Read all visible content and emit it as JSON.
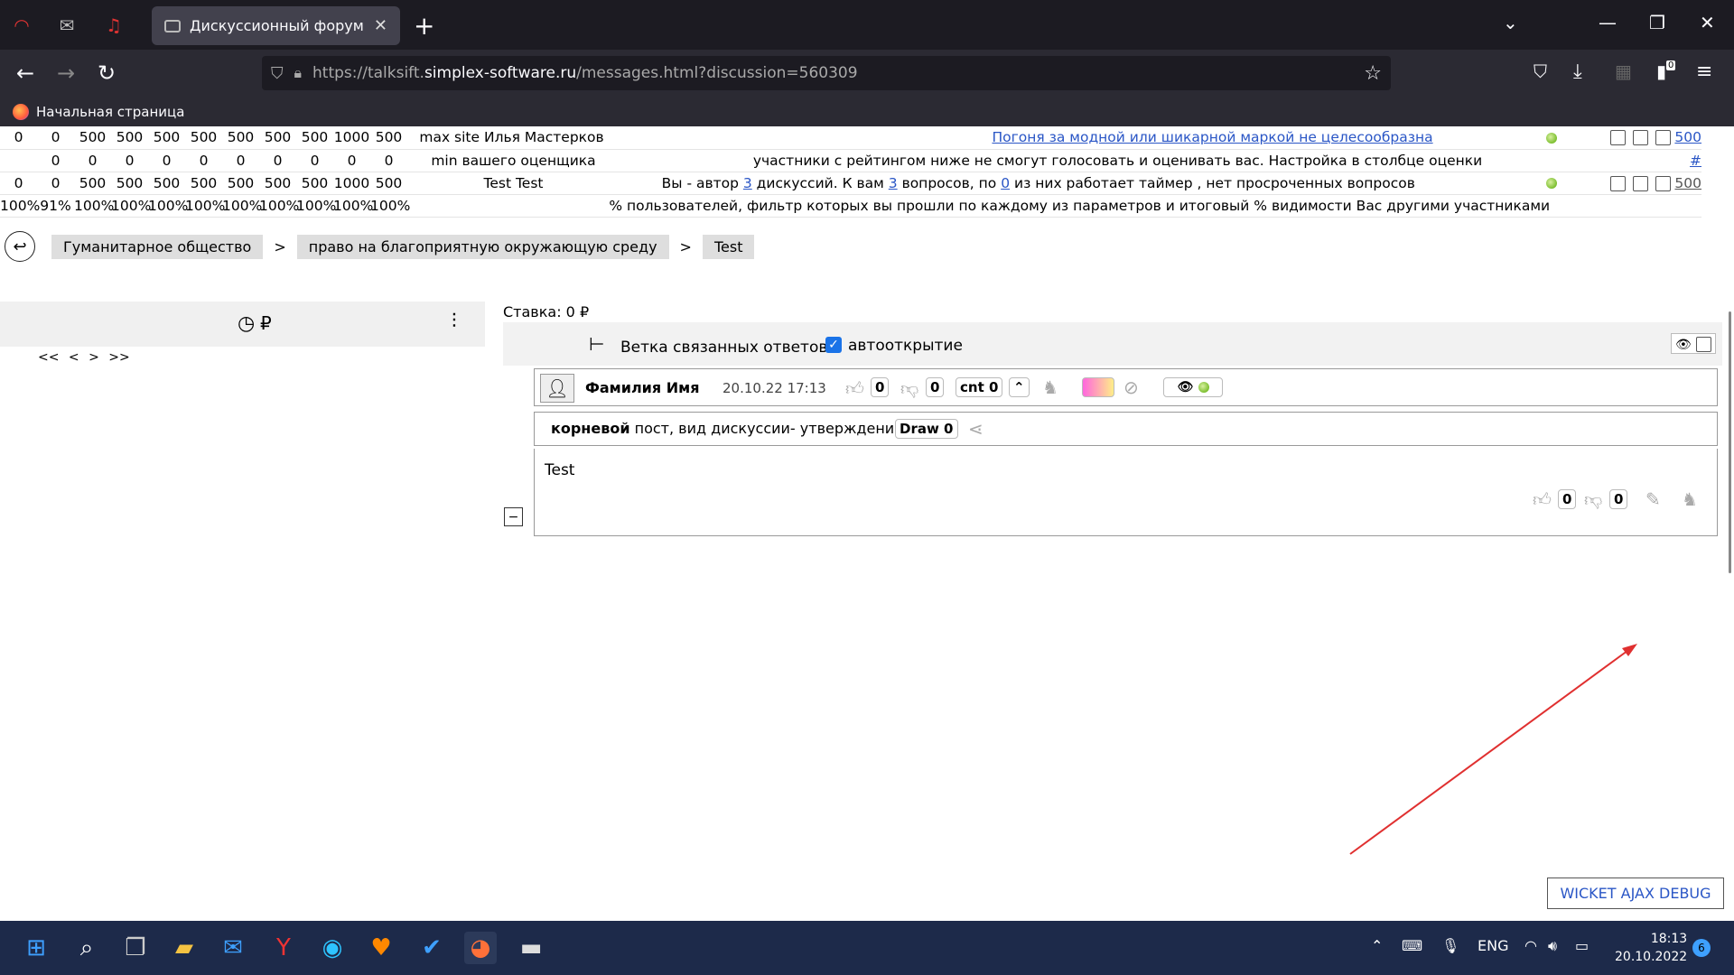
{
  "browser": {
    "tab_title": "Дискуссионный форум",
    "url_prefix": "https://talksift.",
    "url_domain": "simplex-software.ru",
    "url_path": "/messages.html?discussion=560309",
    "bookmark_home": "Начальная страница",
    "extension_badge": "0"
  },
  "stats": {
    "row1": {
      "nums": [
        "0",
        "0",
        "500",
        "500",
        "500",
        "500",
        "500",
        "500",
        "500",
        "1000",
        "500"
      ],
      "label": "max site",
      "name": "Илья Мастерков",
      "link_text": "Погоня за модной или шикарной маркой не целесообразна",
      "score": "500"
    },
    "row2": {
      "nums": [
        "0",
        "0",
        "0",
        "0",
        "0",
        "0",
        "0",
        "0",
        "0",
        "0"
      ],
      "label": "min вашего оценщика",
      "message": "участники с рейтингом ниже не смогут голосовать и оценивать вас. Настройка в столбце оценки",
      "hash": "#"
    },
    "row3": {
      "nums": [
        "0",
        "0",
        "500",
        "500",
        "500",
        "500",
        "500",
        "500",
        "500",
        "1000",
        "500"
      ],
      "name": "Test Test",
      "msg_a": "Вы - автор ",
      "disc_count": "3",
      "msg_b": " дискуссий. К вам ",
      "q_count": "3",
      "msg_c": " вопросов, по ",
      "timer_count": "0",
      "msg_d": " из них работает таймер , нет просроченных вопросов",
      "score": "500"
    },
    "row4": {
      "pcts": [
        "100%",
        "91%",
        "100%",
        "100%",
        "100%",
        "100%",
        "100%",
        "100%",
        "100%",
        "100%",
        "100%"
      ],
      "message": "% пользователей, фильтр которых вы прошли по каждому из параметров и итоговый % видимости Вас другими участниками"
    }
  },
  "breadcrumbs": [
    "Гуманитарное общество",
    "право на благоприятную окружающую среду",
    "Test"
  ],
  "breadcrumb_sep": ">",
  "pager": "<< < > >>",
  "stake": "Ставка: 0 ₽",
  "thread": {
    "title": "Ветка связанных ответов",
    "autoopen_label": "автооткрытие",
    "autoopen_checked": true
  },
  "post": {
    "author": "Фамилия Имя",
    "datetime": "20.10.22 17:13",
    "likes": "0",
    "dislikes": "0",
    "cnt": "cnt 0",
    "root_bold": "корневой",
    "root_rest": " пост, вид дискуссии- утверждение",
    "draw": "Draw 0",
    "body": "Test",
    "body_likes": "0",
    "body_dislikes": "0"
  },
  "debug_button": "WICKET AJAX DEBUG",
  "taskbar": {
    "lang": "ENG",
    "time": "18:13",
    "date": "20.10.2022",
    "notif_count": "6"
  },
  "colors": {
    "link": "#2a56c6",
    "taskbar": "#1d2a4a",
    "browser_dark": "#1c1b22",
    "annotation_arrow": "#e03030"
  }
}
